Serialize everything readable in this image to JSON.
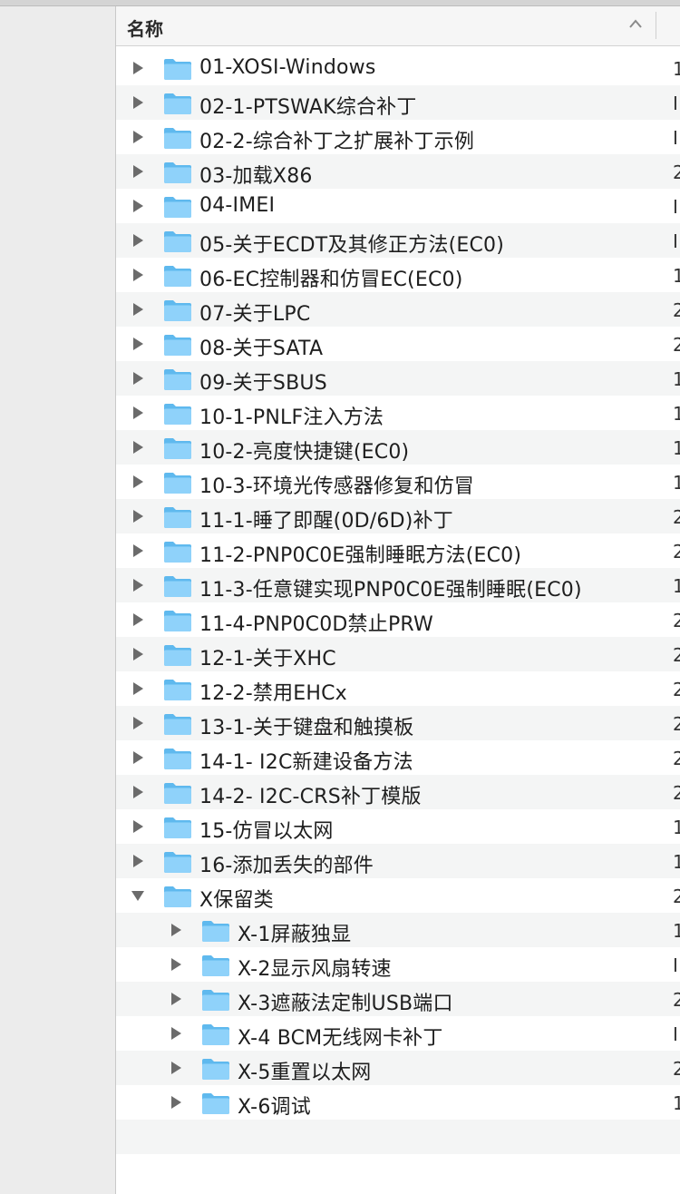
{
  "header": {
    "name_column": "名称"
  },
  "rows": [
    {
      "name": "01-XOSI-Windows",
      "date": "1",
      "depth": 0,
      "expanded": false
    },
    {
      "name": "02-1-PTSWAK综合补丁",
      "date": "I",
      "depth": 0,
      "expanded": false
    },
    {
      "name": "02-2-综合补丁之扩展补丁示例",
      "date": "I",
      "depth": 0,
      "expanded": false
    },
    {
      "name": "03-加载X86",
      "date": "2",
      "depth": 0,
      "expanded": false
    },
    {
      "name": "04-IMEI",
      "date": "I",
      "depth": 0,
      "expanded": false
    },
    {
      "name": "05-关于ECDT及其修正方法(EC0)",
      "date": "I",
      "depth": 0,
      "expanded": false
    },
    {
      "name": "06-EC控制器和仿冒EC(EC0)",
      "date": "1",
      "depth": 0,
      "expanded": false
    },
    {
      "name": "07-关于LPC",
      "date": "2",
      "depth": 0,
      "expanded": false
    },
    {
      "name": "08-关于SATA",
      "date": "2",
      "depth": 0,
      "expanded": false
    },
    {
      "name": "09-关于SBUS",
      "date": "1",
      "depth": 0,
      "expanded": false
    },
    {
      "name": "10-1-PNLF注入方法",
      "date": "1",
      "depth": 0,
      "expanded": false
    },
    {
      "name": "10-2-亮度快捷键(EC0)",
      "date": "1",
      "depth": 0,
      "expanded": false
    },
    {
      "name": "10-3-环境光传感器修复和仿冒",
      "date": "1",
      "depth": 0,
      "expanded": false
    },
    {
      "name": "11-1-睡了即醒(0D/6D)补丁",
      "date": "2",
      "depth": 0,
      "expanded": false
    },
    {
      "name": "11-2-PNP0C0E强制睡眠方法(EC0)",
      "date": "2",
      "depth": 0,
      "expanded": false
    },
    {
      "name": "11-3-任意键实现PNP0C0E强制睡眠(EC0)",
      "date": "1",
      "depth": 0,
      "expanded": false
    },
    {
      "name": "11-4-PNP0C0D禁止PRW",
      "date": "2",
      "depth": 0,
      "expanded": false
    },
    {
      "name": "12-1-关于XHC",
      "date": "2",
      "depth": 0,
      "expanded": false
    },
    {
      "name": "12-2-禁用EHCx",
      "date": "2",
      "depth": 0,
      "expanded": false
    },
    {
      "name": "13-1-关于键盘和触摸板",
      "date": "2",
      "depth": 0,
      "expanded": false
    },
    {
      "name": "14-1- I2C新建设备方法",
      "date": "2",
      "depth": 0,
      "expanded": false
    },
    {
      "name": "14-2- I2C-CRS补丁模版",
      "date": "2",
      "depth": 0,
      "expanded": false
    },
    {
      "name": "15-仿冒以太网",
      "date": "1",
      "depth": 0,
      "expanded": false
    },
    {
      "name": "16-添加丢失的部件",
      "date": "1",
      "depth": 0,
      "expanded": false
    },
    {
      "name": "X保留类",
      "date": "2",
      "depth": 0,
      "expanded": true
    },
    {
      "name": "X-1屏蔽独显",
      "date": "1",
      "depth": 1,
      "expanded": false
    },
    {
      "name": "X-2显示风扇转速",
      "date": "I",
      "depth": 1,
      "expanded": false
    },
    {
      "name": "X-3遮蔽法定制USB端口",
      "date": "2",
      "depth": 1,
      "expanded": false
    },
    {
      "name": "X-4 BCM无线网卡补丁",
      "date": "I",
      "depth": 1,
      "expanded": false
    },
    {
      "name": "X-5重置以太网",
      "date": "2",
      "depth": 1,
      "expanded": false
    },
    {
      "name": "X-6调试",
      "date": "1",
      "depth": 1,
      "expanded": false
    }
  ]
}
